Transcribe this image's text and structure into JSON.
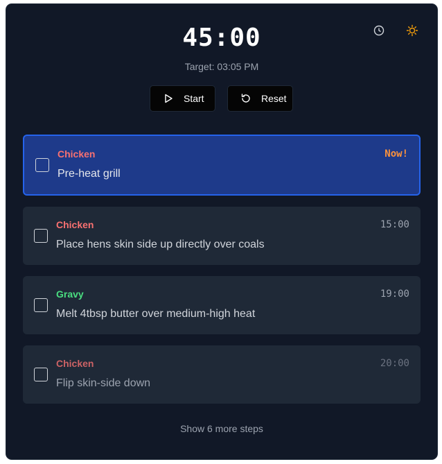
{
  "timer": {
    "display": "45:00",
    "target": "Target: 03:05 PM"
  },
  "header_icons": {
    "history": "clock-icon",
    "theme": "sun-icon",
    "sun_color": "#f59e0b"
  },
  "controls": {
    "start_label": "Start",
    "reset_label": "Reset"
  },
  "steps": [
    {
      "category": "Chicken",
      "category_color": "#f87171",
      "description": "Pre-heat grill",
      "time": "Now!",
      "state": "active"
    },
    {
      "category": "Chicken",
      "category_color": "#f87171",
      "description": "Place hens skin side up directly over coals",
      "time": "15:00",
      "state": "upcoming"
    },
    {
      "category": "Gravy",
      "category_color": "#4ade80",
      "description": "Melt 4tbsp butter over medium-high heat",
      "time": "19:00",
      "state": "upcoming"
    },
    {
      "category": "Chicken",
      "category_color": "#f87171",
      "description": "Flip skin-side down",
      "time": "20:00",
      "state": "faded"
    }
  ],
  "more_label": "Show 6 more steps",
  "colors": {
    "background": "#111827",
    "card": "#1f2937",
    "active_card": "#1e3a8a",
    "active_border": "#2563eb",
    "now": "#fb923c"
  }
}
